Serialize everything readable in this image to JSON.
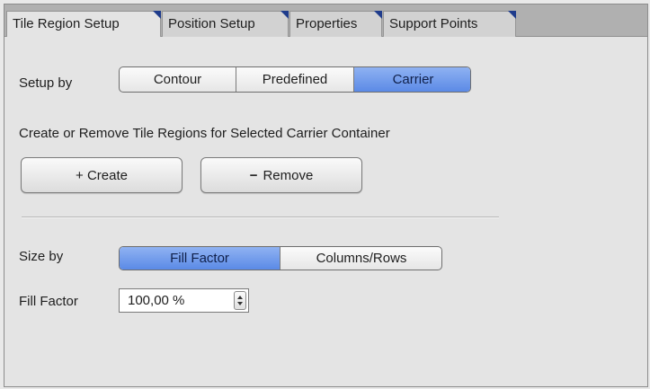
{
  "tabs": [
    {
      "label": "Tile Region Setup",
      "active": true
    },
    {
      "label": "Position Setup",
      "active": false
    },
    {
      "label": "Properties",
      "active": false
    },
    {
      "label": "Support Points",
      "active": false
    }
  ],
  "setup_by": {
    "label": "Setup by",
    "options": [
      "Contour",
      "Predefined",
      "Carrier"
    ],
    "selected": "Carrier"
  },
  "carrier_section": {
    "description": "Create or Remove Tile Regions for Selected Carrier Container",
    "create_label": "+ Create",
    "remove_icon": "−",
    "remove_label": "Remove"
  },
  "size_by": {
    "label": "Size by",
    "options": [
      "Fill Factor",
      "Columns/Rows"
    ],
    "selected": "Fill Factor"
  },
  "fill_factor": {
    "label": "Fill Factor",
    "value": "100,00 %"
  },
  "colors": {
    "selected_segment": "#5b8ae6",
    "tab_corner": "#1f3c8c"
  }
}
